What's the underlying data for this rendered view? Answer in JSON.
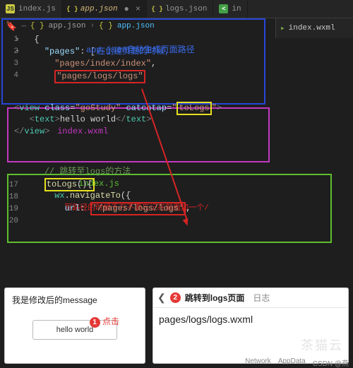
{
  "tabs": [
    {
      "icon": "js",
      "label": "index.js",
      "active": false,
      "dirty": false
    },
    {
      "icon": "json",
      "label": "app.json",
      "active": true,
      "dirty": true
    },
    {
      "icon": "json",
      "label": "logs.json",
      "active": false,
      "dirty": false
    },
    {
      "icon": "wxml",
      "label": "in",
      "active": false,
      "dirty": false
    }
  ],
  "breadcrumb": {
    "file": "app.json",
    "symbol": "app.json"
  },
  "sidebar_file": {
    "label": "index.wxml"
  },
  "annotation": {
    "blue_line1": "在创建页面的时候,",
    "blue_line2": "app.json自动生成页面路径",
    "magenta_label": "index.wxml",
    "green_label": "index.js",
    "red_note": "写路径的时候千万不要忘记在前面加一个/"
  },
  "code_appjson": {
    "lines": [
      "1",
      "2",
      "3",
      "4"
    ],
    "brace_open": "{",
    "pages_key": "\"pages\"",
    "colon_bracket": ": [",
    "page0": "\"pages/index/index\"",
    "comma": ",",
    "page1": "\"pages/logs/logs\""
  },
  "code_wxml": {
    "open_lt": "<",
    "view": "view",
    "sp": " ",
    "class_attr": "class",
    "class_val": "\"goStudy\"",
    "catch_attr": "catchtap",
    "catch_val": "\"",
    "catch_fn": "toLogs",
    "catch_end": "\"",
    "gt": ">",
    "text_tag": "text",
    "hello": "hello world",
    "close_text_l": "</",
    "close_view_l": "</",
    "eq": "="
  },
  "code_js": {
    "lines": [
      "17",
      "18",
      "19",
      "20"
    ],
    "comment": "// 跳转至logs的方法",
    "fn_name": "toLogs",
    "fn_sig": "(){",
    "nav_obj": "wx",
    "nav_dot": ".",
    "nav_fn": "navigateTo",
    "nav_open": "({",
    "url_key": "url",
    "url_colon": ": ",
    "url_val": "'/pages/logs/logs'",
    "url_comma": ","
  },
  "preview_left": {
    "message": "我是修改后的message",
    "badge": "1",
    "click": "点击",
    "button": "hello world"
  },
  "preview_right": {
    "badge": "2",
    "title": "跳转到logs页面",
    "tab2": "日志",
    "path": "pages/logs/logs.wxml"
  },
  "status": {
    "network": "Network",
    "appdata": "AppData",
    "csdn": "CSDN @燕"
  },
  "watermark": "茶猫云"
}
